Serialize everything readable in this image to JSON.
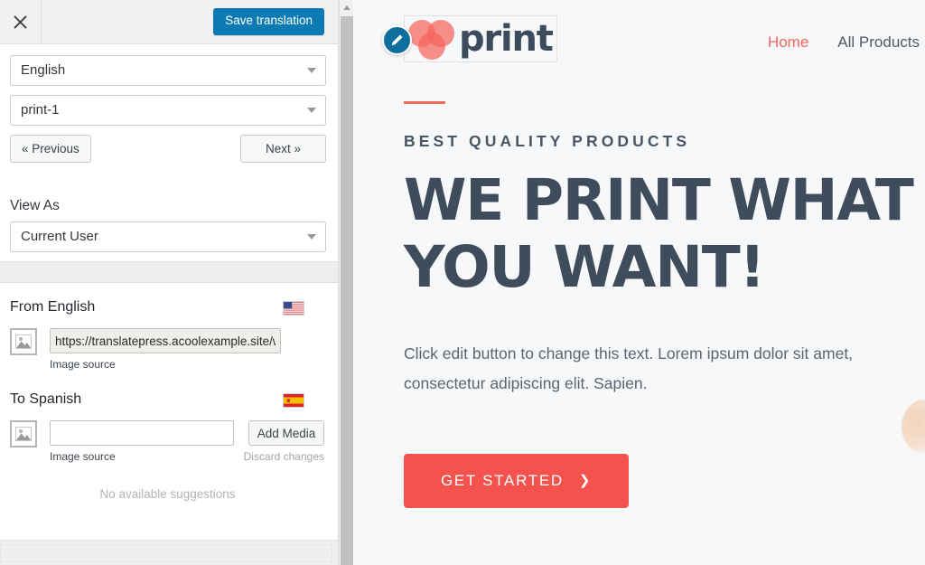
{
  "sidebar": {
    "topbar": {
      "close_icon": "close-x-icon",
      "save_label": "Save translation"
    },
    "language_select": {
      "value": "English",
      "arrow_icon": "chevron-down-icon"
    },
    "string_select": {
      "value": "print-1",
      "arrow_icon": "chevron-down-icon"
    },
    "prev_label": "« Previous",
    "next_label": "Next »",
    "view_as_label": "View As",
    "view_as_select": {
      "value": "Current User",
      "arrow_icon": "chevron-down-icon"
    },
    "from_block": {
      "heading": "From English",
      "flag_icon": "flag-us-icon",
      "thumb_icon": "image-placeholder-icon",
      "input_value": "https://translatepress.acoolexample.site/w",
      "input_placeholder": "",
      "caption": "Image source"
    },
    "to_block": {
      "heading": "To Spanish",
      "flag_icon": "flag-es-icon",
      "thumb_icon": "image-placeholder-icon",
      "input_value": "",
      "input_placeholder": "",
      "caption": "Image source",
      "add_media_label": "Add Media",
      "discard_label": "Discard changes",
      "suggestions_label": "No available suggestions"
    }
  },
  "scrollbar": {
    "up_arrow_icon": "triangle-up-icon"
  },
  "preview": {
    "logo": {
      "text": "print",
      "mark_icon": "three-circles-logo-icon",
      "edit_icon": "pencil-edit-icon"
    },
    "nav": [
      {
        "label": "Home",
        "active": true
      },
      {
        "label": "All Products",
        "active": false
      }
    ],
    "hero": {
      "eyebrow": "BEST QUALITY PRODUCTS",
      "title": "WE PRINT WHAT YOU WANT!",
      "subtitle": "Click edit button to change this text. Lorem ipsum dolor sit amet, consectetur adipiscing elit. Sapien.",
      "cta_label": "GET STARTED",
      "cta_chevron": "chevron-right-icon"
    }
  },
  "colors": {
    "accent_blue": "#0c7ab3",
    "accent_red": "#f4524d",
    "nav_active": "#f4655c",
    "heading": "#3f4c5c",
    "rule": "#ef6c58",
    "body_text": "#5b6571",
    "preview_bg": "#f7f8fa"
  }
}
